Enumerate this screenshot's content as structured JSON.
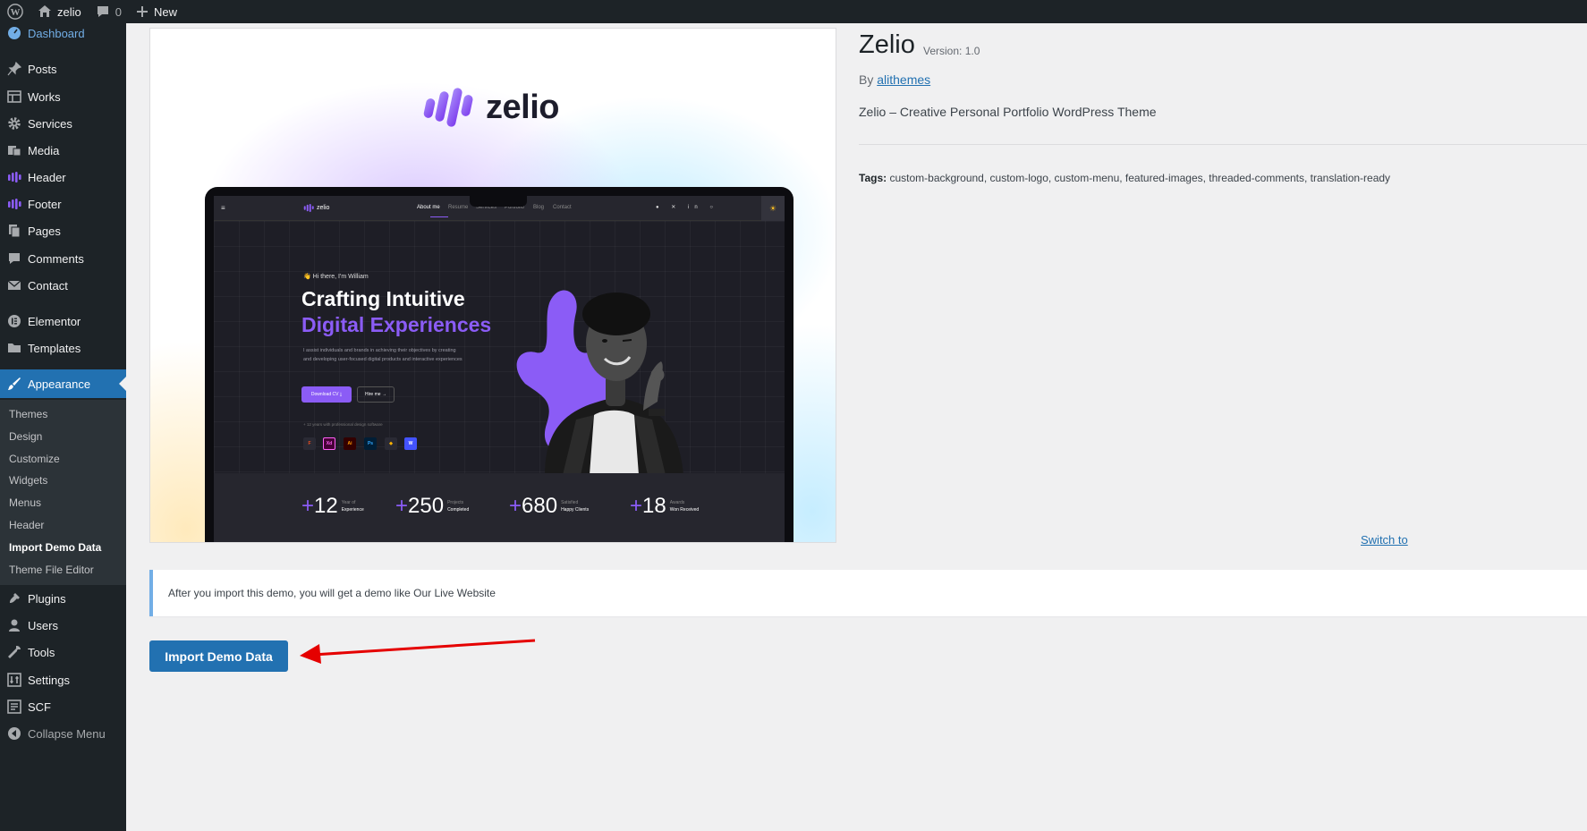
{
  "adminbar": {
    "wp_logo_icon": "wordpress-logo-icon",
    "site_name": "zelio",
    "comments_count": "0",
    "new_label": "New"
  },
  "sidebar": {
    "items": [
      {
        "label": "Dashboard",
        "icon": "dashboard-icon"
      },
      {
        "label": "Posts",
        "icon": "pin-icon"
      },
      {
        "label": "Works",
        "icon": "grid-icon"
      },
      {
        "label": "Services",
        "icon": "gear-icon"
      },
      {
        "label": "Media",
        "icon": "media-icon"
      },
      {
        "label": "Header",
        "icon": "zelio-icon"
      },
      {
        "label": "Footer",
        "icon": "zelio-icon"
      },
      {
        "label": "Pages",
        "icon": "pages-icon"
      },
      {
        "label": "Comments",
        "icon": "comment-icon"
      },
      {
        "label": "Contact",
        "icon": "mail-icon"
      },
      {
        "label": "Elementor",
        "icon": "elementor-icon"
      },
      {
        "label": "Templates",
        "icon": "folder-icon"
      },
      {
        "label": "Appearance",
        "icon": "brush-icon"
      },
      {
        "label": "Plugins",
        "icon": "plug-icon"
      },
      {
        "label": "Users",
        "icon": "user-icon"
      },
      {
        "label": "Tools",
        "icon": "wrench-icon"
      },
      {
        "label": "Settings",
        "icon": "settings-icon"
      },
      {
        "label": "SCF",
        "icon": "scf-icon"
      },
      {
        "label": "Collapse Menu",
        "icon": "collapse-icon"
      }
    ],
    "submenu": [
      "Themes",
      "Design",
      "Customize",
      "Widgets",
      "Menus",
      "Header",
      "Import Demo Data",
      "Theme File Editor"
    ]
  },
  "preview": {
    "logo_text": "zelio",
    "nav_logo": "zelio",
    "nav_links": [
      "About me",
      "Resume",
      "Services",
      "Portfolio",
      "Blog",
      "Contact"
    ],
    "greeting": "👋 Hi there, I'm William",
    "headline_1": "Crafting Intuitive",
    "headline_2": "Digital Experiences",
    "description": "I assist individuals and brands in achieving their objectives by creating and developing user-focused digital products and interactive experiences",
    "btn_cv": "Download CV ⤓",
    "btn_hire": "Hire me →",
    "experience_note": "+ 12 years with professional design software",
    "tools": [
      "F",
      "Xd",
      "Ai",
      "Ps",
      "◆",
      "W"
    ],
    "stats": [
      {
        "num": "12",
        "top": "Year of",
        "bottom": "Experience"
      },
      {
        "num": "250",
        "top": "Projects",
        "bottom": "Completed"
      },
      {
        "num": "680",
        "top": "Satisfied",
        "bottom": "Happy Clients"
      },
      {
        "num": "18",
        "top": "Awards",
        "bottom": "Won Received"
      }
    ],
    "brand_color": "#8b5cf6"
  },
  "theme": {
    "title": "Zelio",
    "version": "Version: 1.0",
    "by": "By",
    "author": "alithemes",
    "description": "Zelio – Creative Personal Portfolio WordPress Theme",
    "tags_label": "Tags:",
    "tags": "custom-background, custom-logo, custom-menu, featured-images, threaded-comments, translation-ready",
    "switch_link": "Switch to"
  },
  "notice": {
    "text": "After you import this demo, you will get a demo like Our Live Website"
  },
  "import_button": "Import Demo Data",
  "colors": {
    "admin_dark": "#1d2327",
    "admin_blue": "#2271b1",
    "annotation_red": "#e50000"
  }
}
